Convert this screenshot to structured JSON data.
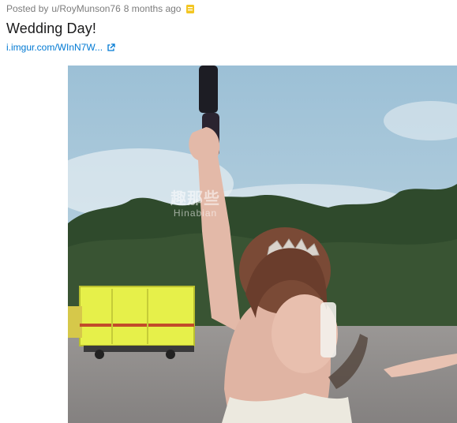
{
  "post": {
    "posted_by_prefix": "Posted by",
    "author": "u/RoyMunson76",
    "age": "8 months ago",
    "award_icon": "gold-award-icon",
    "title": "Wedding Day!",
    "link_text": "i.imgur.com/WInN7W...",
    "link_icon": "external-link-icon"
  },
  "media": {
    "type": "image",
    "watermark_main": "趣那些",
    "watermark_sub": "Hinabian",
    "colors": {
      "sky": "#a9c6d9",
      "trees": "#2f4a2c",
      "ground": "#8f8c8b",
      "truck": "#e6f04a",
      "dress": "#ece9df"
    }
  }
}
